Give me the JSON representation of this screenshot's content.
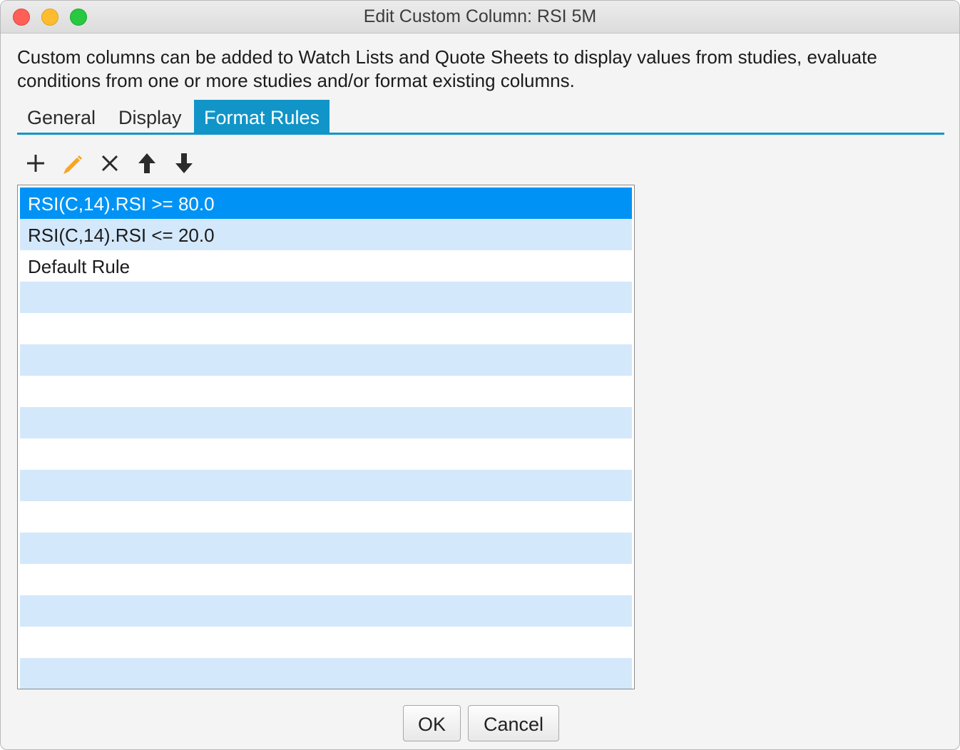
{
  "window": {
    "title": "Edit Custom Column: RSI 5M"
  },
  "description": "Custom columns can be added to Watch Lists and Quote Sheets to display values from studies, evaluate conditions from one or more studies and/or format existing columns.",
  "tabs": [
    {
      "label": "General",
      "active": false
    },
    {
      "label": "Display",
      "active": false
    },
    {
      "label": "Format Rules",
      "active": true
    }
  ],
  "toolbar": {
    "icons": [
      "plus-icon",
      "pencil-icon",
      "close-icon",
      "arrow-up-icon",
      "arrow-down-icon"
    ],
    "accent_color": "#f5a623"
  },
  "rules": {
    "selected_index": 0,
    "items": [
      "RSI(C,14).RSI >= 80.0",
      "RSI(C,14).RSI <= 20.0",
      "Default Rule"
    ]
  },
  "colors": {
    "tab_active": "#1195c8",
    "row_selected": "#0093f5",
    "row_stripe": "#d4e8fb"
  },
  "buttons": {
    "ok_label": "OK",
    "cancel_label": "Cancel"
  }
}
